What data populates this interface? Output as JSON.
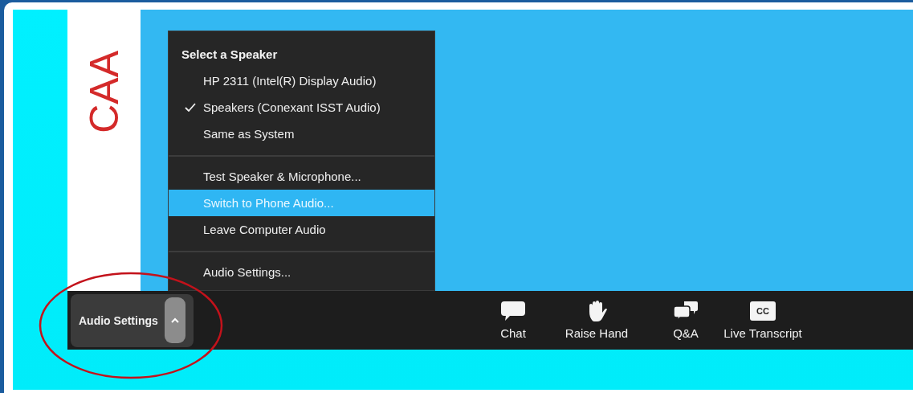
{
  "slide": {
    "text": "CAA"
  },
  "menu": {
    "sections": [
      {
        "title": "Select a Speaker",
        "items": [
          {
            "label": "HP 2311 (Intel(R) Display Audio)",
            "checked": false
          },
          {
            "label": "Speakers (Conexant ISST Audio)",
            "checked": true
          },
          {
            "label": "Same as System",
            "checked": false
          }
        ]
      },
      {
        "items": [
          {
            "label": "Test Speaker & Microphone...",
            "highlighted": false
          },
          {
            "label": "Switch to Phone Audio...",
            "highlighted": true
          },
          {
            "label": "Leave Computer Audio",
            "highlighted": false
          }
        ]
      },
      {
        "items": [
          {
            "label": "Audio Settings...",
            "highlighted": false
          }
        ]
      }
    ]
  },
  "toolbar": {
    "audio_button": {
      "label": "Audio Settings",
      "expanded": true
    },
    "items": [
      {
        "kind": "chat",
        "label": "Chat"
      },
      {
        "kind": "hand",
        "label": "Raise Hand"
      },
      {
        "kind": "qa",
        "label": "Q&A"
      },
      {
        "kind": "cc",
        "label": "Live Transcript",
        "icon_text": "CC"
      }
    ]
  },
  "annotation": {
    "kind": "ellipse"
  }
}
